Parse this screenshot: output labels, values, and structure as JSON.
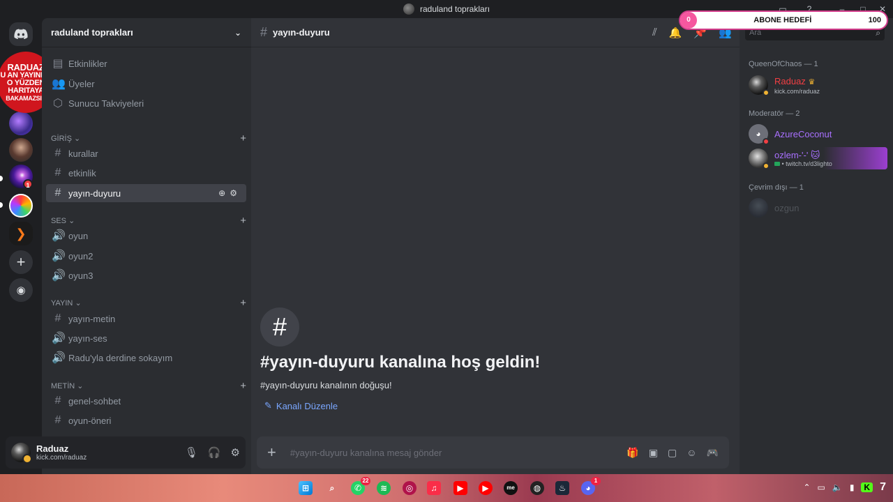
{
  "window": {
    "title": "raduland toprakları"
  },
  "overlay": {
    "current": "0",
    "label": "ABONE HEDEFİ",
    "goal": "100"
  },
  "promo": {
    "line1": "RADUAZ",
    "line2": "U AN YAYINDA",
    "line3": "O YÜZDEN",
    "line4": "HARITAYA",
    "line5": "BAKAMAZSIN"
  },
  "server": {
    "name": "raduland toprakları"
  },
  "rail": {
    "badge_a": "1"
  },
  "nav": {
    "events": "Etkinlikler",
    "members": "Üyeler",
    "boosts": "Sunucu Takviyeleri"
  },
  "categories": {
    "giris": "GİRİŞ",
    "ses": "SES",
    "yayin": "YAYIN",
    "metin": "METİN"
  },
  "channels": {
    "kurallar": "kurallar",
    "etkinlik": "etkinlik",
    "yayin_duyuru": "yayın-duyuru",
    "oyun": "oyun",
    "oyun2": "oyun2",
    "oyun3": "oyun3",
    "yayin_metin": "yayın-metin",
    "yayin_ses": "yayın-ses",
    "radu_sokak": "Radu'yla derdine sokayım",
    "genel_sohbet": "genel-sohbet",
    "oyun_oneri": "oyun-öneri"
  },
  "user": {
    "name": "Raduaz",
    "status": "kick.com/raduaz"
  },
  "chat": {
    "channel": "yayın-duyuru",
    "welcome_title": "#yayın-duyuru kanalına hoş geldin!",
    "welcome_sub": "#yayın-duyuru kanalının doğuşu!",
    "edit_label": "Kanalı Düzenle",
    "composer_placeholder": "#yayın-duyuru kanalına mesaj gönder"
  },
  "members": {
    "search_placeholder": "Ara",
    "group1": "QueenOfChaos — 1",
    "m1_name": "Raduaz",
    "m1_sub": "kick.com/raduaz",
    "group2": "Moderatör — 2",
    "m2_name": "AzureCoconut",
    "m3_name": "ozlem-'-' 🐱",
    "m3_sub": "• twitch.tv/d3lighto",
    "group3": "Çevrim dışı — 1",
    "m4_name": "ozgun"
  },
  "taskbar": {
    "whatsapp_badge": "22",
    "discord_badge": "1",
    "tray_num": "7"
  },
  "colors": {
    "accent_link": "#7aa7ff",
    "owner_red": "#f23f43",
    "mod_purple": "#a970ff",
    "status_idle": "#f0b232"
  }
}
